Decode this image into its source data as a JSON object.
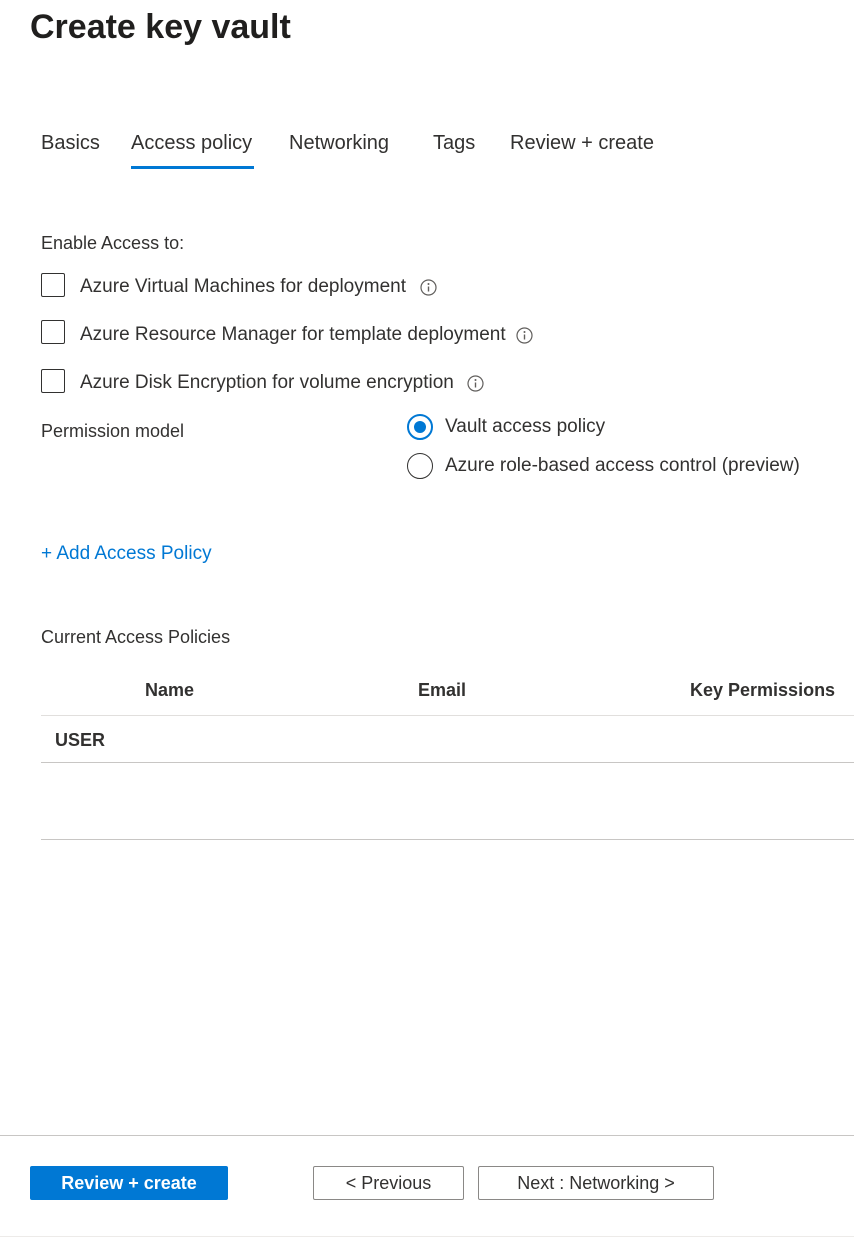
{
  "page_title": "Create key vault",
  "tabs": [
    {
      "label": "Basics"
    },
    {
      "label": "Access policy",
      "active": true
    },
    {
      "label": "Networking"
    },
    {
      "label": "Tags"
    },
    {
      "label": "Review + create"
    }
  ],
  "enable_access": {
    "label": "Enable Access to:",
    "options": [
      {
        "label": "Azure Virtual Machines for deployment",
        "checked": false,
        "icon": "info-icon"
      },
      {
        "label": "Azure Resource Manager for template deployment",
        "checked": false,
        "icon": "info-icon"
      },
      {
        "label": "Azure Disk Encryption for volume encryption",
        "checked": false,
        "icon": "info-icon"
      }
    ]
  },
  "permission_model": {
    "label": "Permission model",
    "options": [
      {
        "label": "Vault access policy",
        "selected": true
      },
      {
        "label": "Azure role-based access control (preview)",
        "selected": false
      }
    ]
  },
  "add_policy_link": "+ Add Access Policy",
  "policies": {
    "label": "Current Access Policies",
    "columns": [
      "Name",
      "Email",
      "Key Permissions"
    ],
    "rows": [
      {
        "name": "USER"
      }
    ]
  },
  "footer": {
    "review_create": "Review + create",
    "previous": "< Previous",
    "next": "Next : Networking >"
  },
  "colors": {
    "accent": "#0078d4",
    "text": "#323130"
  }
}
